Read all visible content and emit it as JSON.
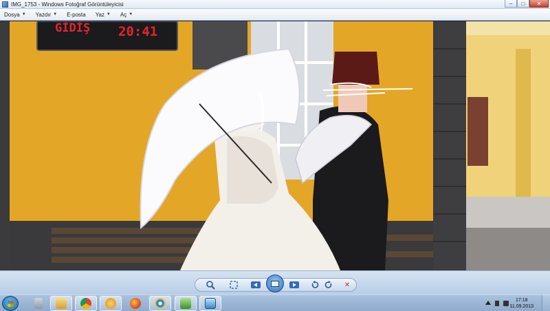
{
  "window": {
    "title": "IMG_1753 - Windows Fotoğraf Görüntüleyicisi",
    "minimize": "–",
    "maximize": "□",
    "close": "✕"
  },
  "menu": [
    {
      "label": "Dosya"
    },
    {
      "label": "Yazdır"
    },
    {
      "label": "E-posta"
    },
    {
      "label": "Yaz"
    },
    {
      "label": "Aç"
    }
  ],
  "photo": {
    "sign_left": "GİDİŞ",
    "sign_right": "20:41"
  },
  "controls": {
    "zoom_icon": "magnifier-icon",
    "fit_icon": "actual-size-icon",
    "prev_icon": "previous-icon",
    "slideshow_icon": "slideshow-icon",
    "next_icon": "next-icon",
    "rotate_ccw_icon": "rotate-counterclockwise-icon",
    "rotate_cw_icon": "rotate-clockwise-icon",
    "delete_icon": "delete-icon",
    "delete_color": "#d42a1e"
  },
  "taskbar": {
    "items": [
      {
        "name": "file-manager-icon"
      },
      {
        "name": "explorer-icon"
      },
      {
        "name": "chrome-icon"
      },
      {
        "name": "media-player-icon"
      },
      {
        "name": "firefox-icon"
      },
      {
        "name": "internet-explorer-icon"
      },
      {
        "name": "network-icon"
      },
      {
        "name": "photo-viewer-icon"
      }
    ],
    "clock_time": "17:18",
    "clock_date": "11.09.2013"
  }
}
